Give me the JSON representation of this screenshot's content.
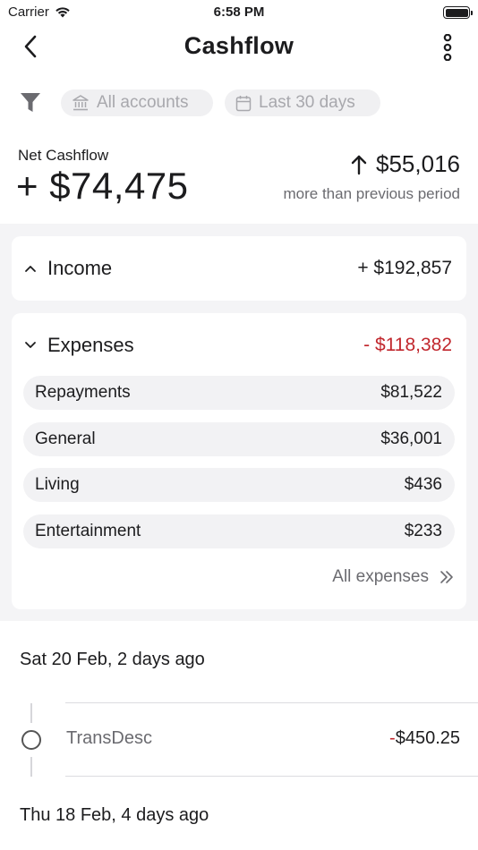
{
  "status_bar": {
    "carrier": "Carrier",
    "time": "6:58 PM"
  },
  "nav": {
    "title": "Cashflow"
  },
  "filters": {
    "accounts": "All accounts",
    "period": "Last 30 days"
  },
  "summary": {
    "net_label": "Net Cashflow",
    "net_value": "+ $74,475",
    "delta_value": "$55,016",
    "delta_caption": "more than previous period"
  },
  "income": {
    "label": "Income",
    "amount": "+ $192,857"
  },
  "expenses": {
    "label": "Expenses",
    "amount": "- $118,382",
    "rows": [
      {
        "name": "Repayments",
        "amount": "$81,522"
      },
      {
        "name": "General",
        "amount": "$36,001"
      },
      {
        "name": "Living",
        "amount": "$436"
      },
      {
        "name": "Entertainment",
        "amount": "$233"
      }
    ],
    "all_link": "All expenses"
  },
  "transactions": {
    "groups": [
      {
        "date": "Sat 20 Feb, 2 days ago"
      },
      {
        "date": "Thu 18 Feb, 4 days ago"
      }
    ],
    "items": [
      {
        "desc": "TransDesc",
        "sign": "-",
        "amount": "$450.25"
      }
    ]
  },
  "colors": {
    "negative": "#c1272d",
    "panel_bg": "#f4f4f6",
    "chip_bg": "#f0f0f2",
    "muted_text": "#6b6b70"
  }
}
